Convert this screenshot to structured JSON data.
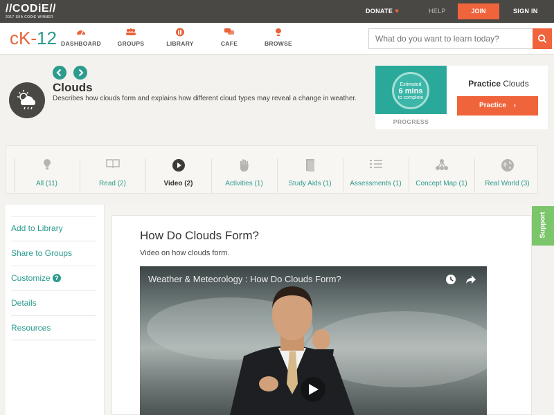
{
  "topbar": {
    "codie_logo": "//CODiE//",
    "codie_sub": "2017 SIIA CODiE WINNER",
    "donate": "DONATE",
    "help": "HELP",
    "join": "JOIN",
    "signin": "SIGN IN"
  },
  "brand": {
    "c": "c",
    "k": "K-",
    "n": "12"
  },
  "nav": {
    "items": [
      {
        "label": "DASHBOARD",
        "icon": "dashboard-icon"
      },
      {
        "label": "GROUPS",
        "icon": "groups-icon"
      },
      {
        "label": "LIBRARY",
        "icon": "library-icon"
      },
      {
        "label": "CAFE",
        "icon": "cafe-icon"
      },
      {
        "label": "BROWSE",
        "icon": "browse-icon"
      }
    ],
    "search_placeholder": "What do you want to learn today?"
  },
  "concept": {
    "title": "Clouds",
    "description": "Describes how clouds form and explains how different cloud types may reveal a change in weather."
  },
  "practice": {
    "estimate_top": "Estimated",
    "estimate_mins": "6 mins",
    "estimate_bottom": "to complete",
    "progress": "PROGRESS",
    "title": "Practice Clouds",
    "button": "Practice"
  },
  "tabs": [
    {
      "label": "All (11)",
      "icon": "lightbulb-icon"
    },
    {
      "label": "Read (2)",
      "icon": "book-icon"
    },
    {
      "label": "Video (2)",
      "icon": "play-icon"
    },
    {
      "label": "Activities (1)",
      "icon": "hand-icon"
    },
    {
      "label": "Study Aids (1)",
      "icon": "document-icon"
    },
    {
      "label": "Assessments (1)",
      "icon": "checklist-icon"
    },
    {
      "label": "Concept Map (1)",
      "icon": "concept-map-icon"
    },
    {
      "label": "Real World (3)",
      "icon": "globe-icon"
    }
  ],
  "active_tab": "Video (2)",
  "sidebar": {
    "items": [
      "Add to Library",
      "Share to Groups",
      "Customize",
      "Details",
      "Resources"
    ]
  },
  "video": {
    "heading": "How Do Clouds Form?",
    "description": "Video on how clouds form.",
    "player_title": "Weather & Meteorology : How Do Clouds Form?"
  },
  "support": "Support",
  "colors": {
    "accent": "#f0643c",
    "teal": "#2d9b8e",
    "topbar": "#4a4845",
    "support": "#7bc56b"
  }
}
